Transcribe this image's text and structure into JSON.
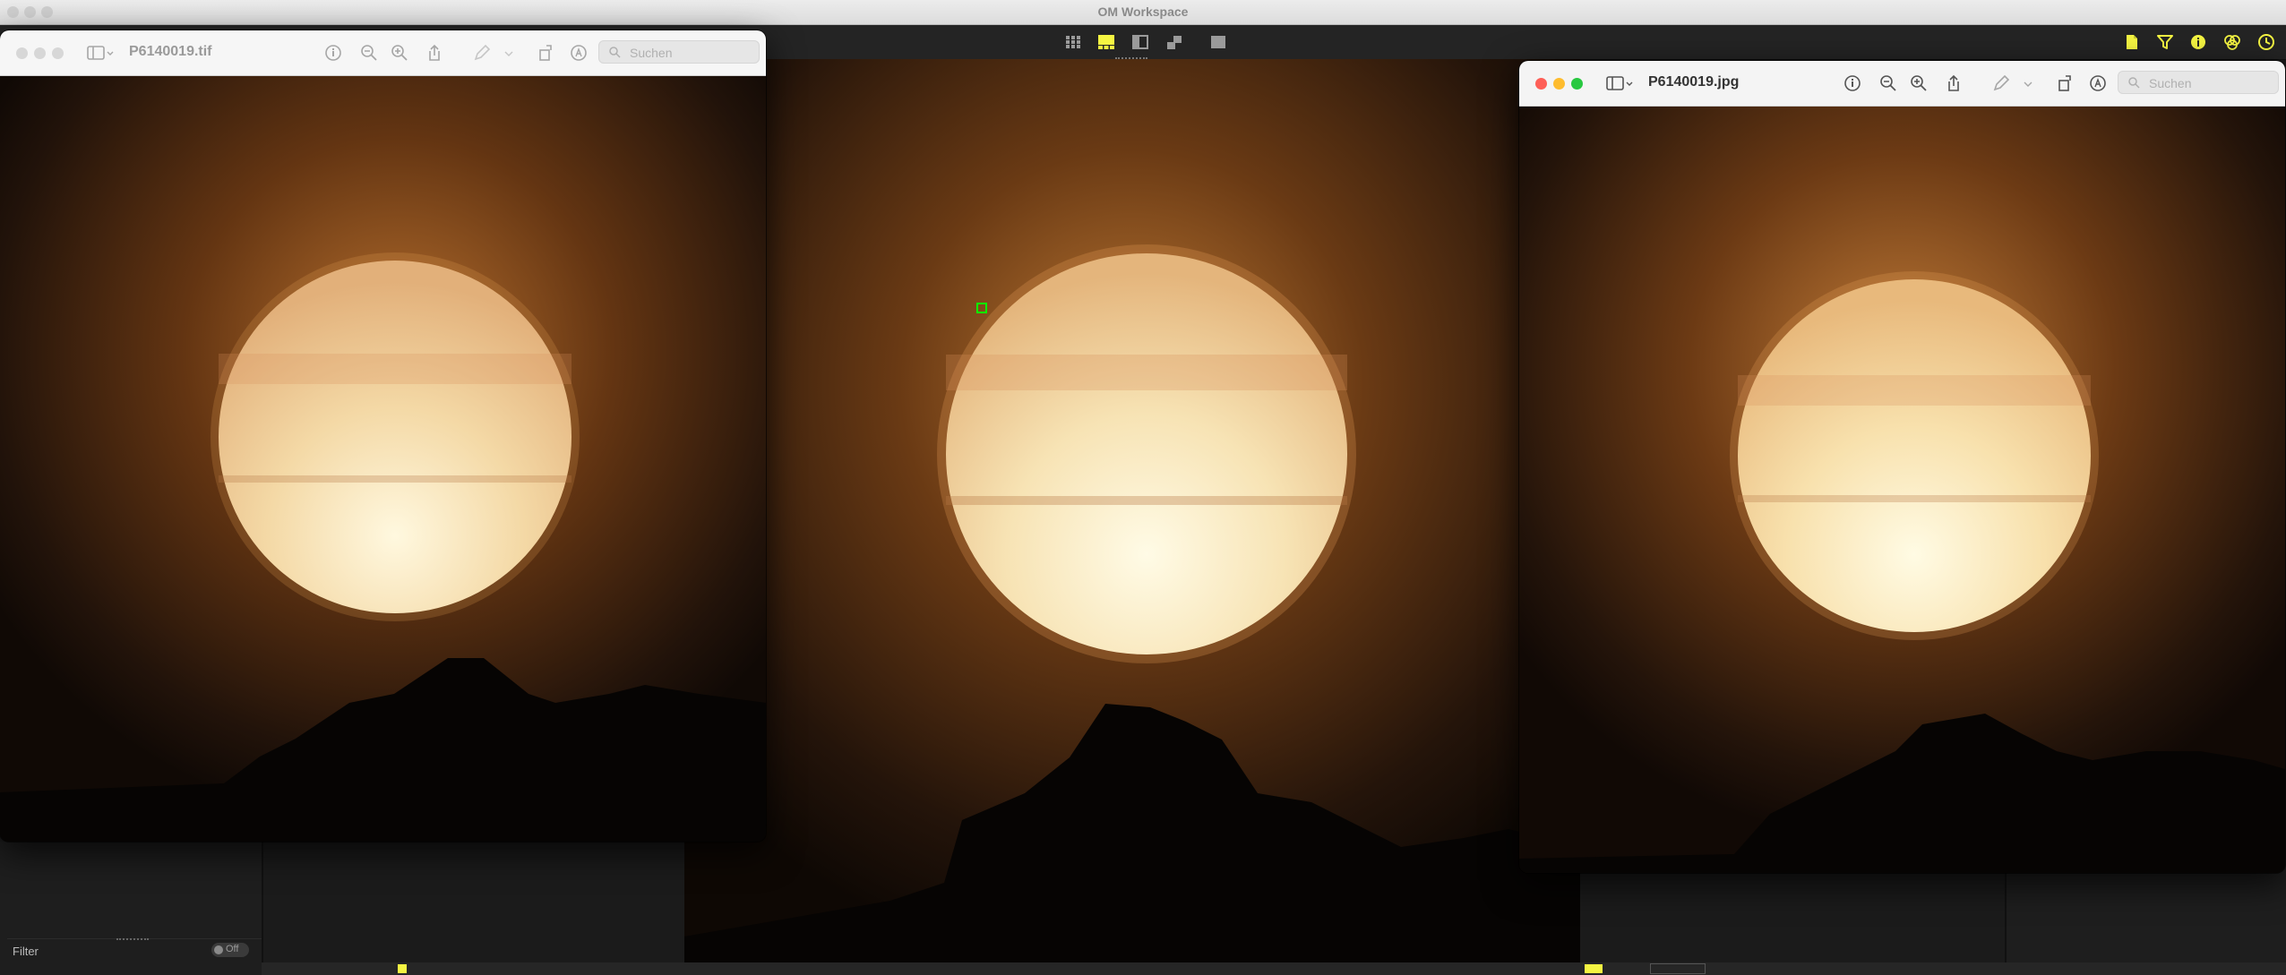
{
  "app": {
    "title": "OM Workspace",
    "accent": "#f5f542"
  },
  "toolbar": {
    "view_modes": [
      "grid-view-icon",
      "filmstrip-view-icon",
      "list-view-icon",
      "compare-view-icon",
      "single-view-icon"
    ],
    "active_view": "filmstrip-view-icon",
    "right_tools": [
      "document-icon",
      "filter-icon",
      "info-icon",
      "color-adjust-icon",
      "history-icon"
    ]
  },
  "windows": [
    {
      "filename": "P6140019.tif",
      "search_placeholder": "Suchen",
      "state": "inactive"
    },
    {
      "filename": "P6140019.jpg",
      "search_placeholder": "Suchen",
      "state": "active"
    }
  ],
  "side_panel": {
    "filter_label": "Filter",
    "filter_toggle": "Off"
  },
  "colors": {
    "sky_dark": "#140b04",
    "glow": "#b86a2a",
    "moon_light": "#fff6d8",
    "moon_mid": "#f2d39a"
  }
}
